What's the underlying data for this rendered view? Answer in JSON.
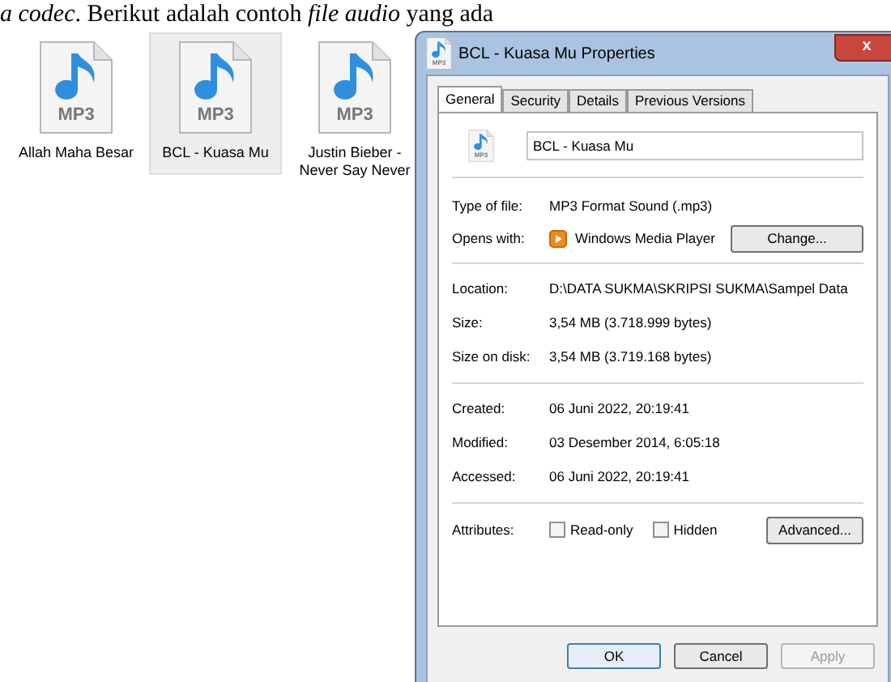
{
  "document_text": "*a codec*. Berikut adalah contoh *file audio* yang ada",
  "files": [
    {
      "name": "Allah Maha Besar",
      "badge": "MP3",
      "selected": false
    },
    {
      "name": "BCL - Kuasa Mu",
      "badge": "MP3",
      "selected": true
    },
    {
      "name": "Justin Bieber - Never Say Never",
      "badge": "MP3",
      "selected": false
    }
  ],
  "dialog": {
    "title": "BCL - Kuasa Mu Properties",
    "close": "x",
    "tabs": [
      {
        "label": "General",
        "selected": true
      },
      {
        "label": "Security",
        "selected": false
      },
      {
        "label": "Details",
        "selected": false
      },
      {
        "label": "Previous Versions",
        "selected": false
      }
    ],
    "title_badge": "MP3",
    "file_badge": "MP3",
    "name_value": "BCL - Kuasa Mu",
    "type_label": "Type of file:",
    "type_value": "MP3 Format Sound (.mp3)",
    "opens_label": "Opens with:",
    "opens_value": "Windows Media Player",
    "change_button": "Change...",
    "groups": [
      [
        {
          "label": "Location:",
          "value": "D:\\DATA SUKMA\\SKRIPSI SUKMA\\Sampel Data"
        },
        {
          "label": "Size:",
          "value": "3,54 MB (3.718.999 bytes)"
        },
        {
          "label": "Size on disk:",
          "value": "3,54 MB (3.719.168 bytes)"
        }
      ],
      [
        {
          "label": "Created:",
          "value": "06 Juni 2022, 20:19:41"
        },
        {
          "label": "Modified:",
          "value": "03 Desember 2014, 6:05:18"
        },
        {
          "label": "Accessed:",
          "value": "06 Juni 2022, 20:19:41"
        }
      ]
    ],
    "attributes_label": "Attributes:",
    "attributes": [
      {
        "label": "Read-only",
        "checked": false
      },
      {
        "label": "Hidden",
        "checked": false
      }
    ],
    "advanced_button": "Advanced...",
    "buttons": [
      {
        "label": "OK",
        "disabled": false,
        "default": true
      },
      {
        "label": "Cancel",
        "disabled": false,
        "default": false
      },
      {
        "label": "Apply",
        "disabled": true,
        "default": false
      }
    ]
  }
}
